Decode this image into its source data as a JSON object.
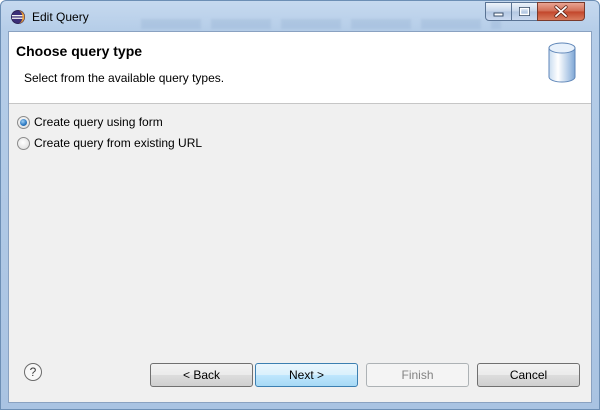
{
  "window": {
    "title": "Edit Query"
  },
  "header": {
    "title": "Choose query type",
    "description": "Select from the available query types."
  },
  "options": [
    {
      "label": "Create query using form",
      "selected": true
    },
    {
      "label": "Create query from existing URL",
      "selected": false
    }
  ],
  "buttons": {
    "help_label": "?",
    "back_label": "< Back",
    "next_label": "Next >",
    "finish_label": "Finish",
    "cancel_label": "Cancel",
    "finish_enabled": false
  },
  "icons": {
    "app": "eclipse-icon",
    "header": "database-icon",
    "help": "help-icon"
  },
  "colors": {
    "title_bar": "#b5cde8",
    "close_button": "#c2452a",
    "default_button": "#bee6fd",
    "radio_selected": "#2f7cc5"
  }
}
